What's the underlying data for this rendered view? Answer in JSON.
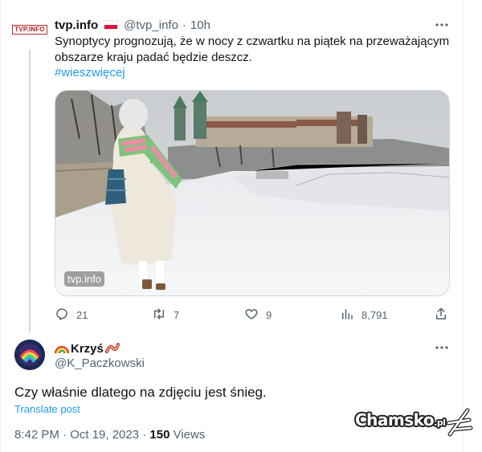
{
  "tweet": {
    "avatar_text": "TVP.INFO",
    "author_name": "tvp.info",
    "handle": "@tvp_info",
    "separator": "·",
    "time": "10h",
    "text": "Synoptycy prognozują, że w nocy z czwartku na piątek na przeważającym obszarze kraju padać będzie deszcz.",
    "hashtag": "#wieszwięcej",
    "photo_watermark": "tvp.info",
    "actions": {
      "replies": "21",
      "reposts": "7",
      "likes": "9",
      "views": "8,791"
    },
    "icons": [
      "more-icon",
      "reply-icon",
      "repost-icon",
      "like-icon",
      "views-icon",
      "share-icon"
    ]
  },
  "reply": {
    "author_name": "Krzyś",
    "handle": "@K_Paczkowski",
    "text": "Czy właśnie dlatego na zdjęciu jest śnieg.",
    "translate": "Translate post",
    "timestamp": "8:42 PM · Oct 19, 2023 · ",
    "views_count": "150",
    "views_label": " Views"
  },
  "watermark": {
    "brand": "Chamsko",
    "suffix": ".pl"
  },
  "colors": {
    "text": "#0f1419",
    "secondary": "#536471",
    "link": "#1d9bf0",
    "divider": "#cfd9de"
  }
}
